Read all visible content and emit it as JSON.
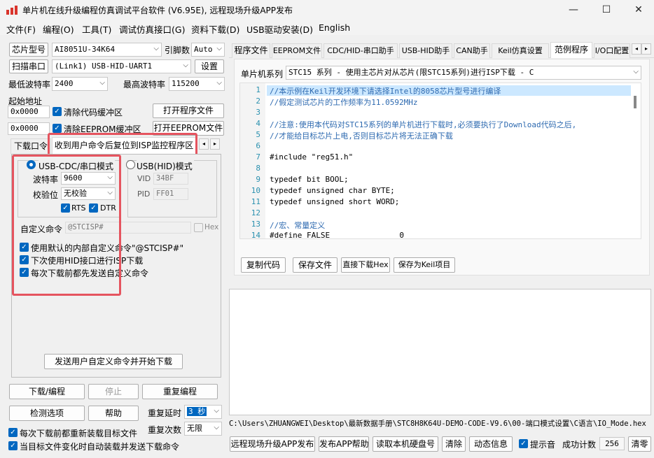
{
  "window": {
    "title": "单片机在线升级编程仿真调试平台软件 (V6.95E), 远程现场升级APP发布",
    "minimize": "—",
    "maximize": "☐",
    "close": "✕"
  },
  "menu": [
    "文件(F)",
    "编程(O)",
    "工具(T)",
    "调试仿真接口(G)",
    "资料下载(D)",
    "USB驱动安装(D)",
    "English"
  ],
  "left": {
    "chip_label": "芯片型号",
    "chip_value": "AI8051U-34K64",
    "pins_label": "引脚数",
    "pins_value": "Auto",
    "scan_label": "扫描串口",
    "port_value": "(Link1) USB-HID-UART1",
    "settings_label": "设置",
    "min_baud_label": "最低波特率",
    "min_baud_value": "2400",
    "max_baud_label": "最高波特率",
    "max_baud_value": "115200",
    "start_addr_label": "起始地址",
    "addr1": "0x0000",
    "clear_code_label": "清除代码缓冲区",
    "open_prog_label": "打开程序文件",
    "addr2": "0x0000",
    "clear_eeprom_label": "清除EEPROM缓冲区",
    "open_eeprom_label": "打开EEPROM文件",
    "tabs": [
      "下载口令",
      "收到用户命令后复位到ISP监控程序区"
    ],
    "tab_prev": "◂",
    "tab_next": "▸",
    "usb_cdc_label": "USB-CDC/串口模式",
    "usb_hid_label": "USB(HID)模式",
    "baud_label": "波特率",
    "baud_value": "9600",
    "parity_label": "校验位",
    "parity_value": "无校验",
    "rts_label": "RTS",
    "dtr_label": "DTR",
    "vid_label": "VID",
    "vid_value": "34BF",
    "pid_label": "PID",
    "pid_value": "FF01",
    "custom_cmd_label": "自定义命令",
    "custom_cmd_value": "@STCISP#",
    "hex_label": "Hex",
    "opt1": "使用默认的内部自定义命令\"@STCISP#\"",
    "opt2": "下次使用HID接口进行ISP下载",
    "opt3": "每次下载前都先发送自定义命令",
    "send_cmd_label": "发送用户自定义命令并开始下载",
    "download_label": "下载/编程",
    "stop_label": "停止",
    "reprogram_label": "重复编程",
    "check_label": "检测选项",
    "help_label": "帮助",
    "repeat_delay_label": "重复延时",
    "repeat_delay_value": "3 秒",
    "repeat_count_label": "重复次数",
    "repeat_count_value": "无限",
    "reload_label": "每次下载前都重新装载目标文件",
    "auto_load_label": "当目标文件变化时自动装载并发送下载命令"
  },
  "right": {
    "tabs": [
      "程序文件",
      "EEPROM文件",
      "CDC/HID-串口助手",
      "USB-HID助手",
      "CAN助手",
      "Keil仿真设置",
      "范例程序",
      "I/O口配置"
    ],
    "mcu_series_label": "单片机系列",
    "series_value": "STC15 系列 - 使用主芯片对从芯片(限STC15系列)进行ISP下载 - C",
    "code_lines": [
      {
        "n": "1",
        "t": "//本示例在Keil开发环境下请选择Intel的8058芯片型号进行编译",
        "c": "comment"
      },
      {
        "n": "2",
        "t": "//假定测试芯片的工作频率为11.0592MHz",
        "c": "comment"
      },
      {
        "n": "3",
        "t": "",
        "c": "plain"
      },
      {
        "n": "4",
        "t": "//注意:使用本代码对STC15系列的单片机进行下载时,必须要执行了Download代码之后,",
        "c": "comment"
      },
      {
        "n": "5",
        "t": "//才能给目标芯片上电,否则目标芯片将无法正确下载",
        "c": "comment"
      },
      {
        "n": "6",
        "t": "",
        "c": "plain"
      },
      {
        "n": "7",
        "t": "#include \"reg51.h\"",
        "c": "plain"
      },
      {
        "n": "8",
        "t": "",
        "c": "plain"
      },
      {
        "n": "9",
        "t": "typedef bit BOOL;",
        "c": "plain"
      },
      {
        "n": "10",
        "t": "typedef unsigned char BYTE;",
        "c": "plain"
      },
      {
        "n": "11",
        "t": "typedef unsigned short WORD;",
        "c": "plain"
      },
      {
        "n": "12",
        "t": "",
        "c": "plain"
      },
      {
        "n": "13",
        "t": "//宏、常量定义",
        "c": "comment"
      },
      {
        "n": "14",
        "t": "#define FALSE               0",
        "c": "plain"
      }
    ],
    "copy_code_label": "复制代码",
    "save_file_label": "保存文件",
    "direct_hex_label": "直接下载Hex",
    "save_keil_label": "保存为Keil项目",
    "path_value": "C:\\Users\\ZHUANGWEI\\Desktop\\最新数据手册\\STC8H8K64U-DEMO-CODE-V9.6\\00-端口模式设置\\C语言\\IO_Mode.hex",
    "remote_label": "远程现场升级APP发布",
    "publish_help_label": "发布APP帮助",
    "read_disk_label": "读取本机硬盘号",
    "clear_label": "清除",
    "dynamic_label": "动态信息",
    "beep_label": "提示音",
    "success_label": "成功计数",
    "success_value": "256",
    "clear_count_label": "清零"
  }
}
